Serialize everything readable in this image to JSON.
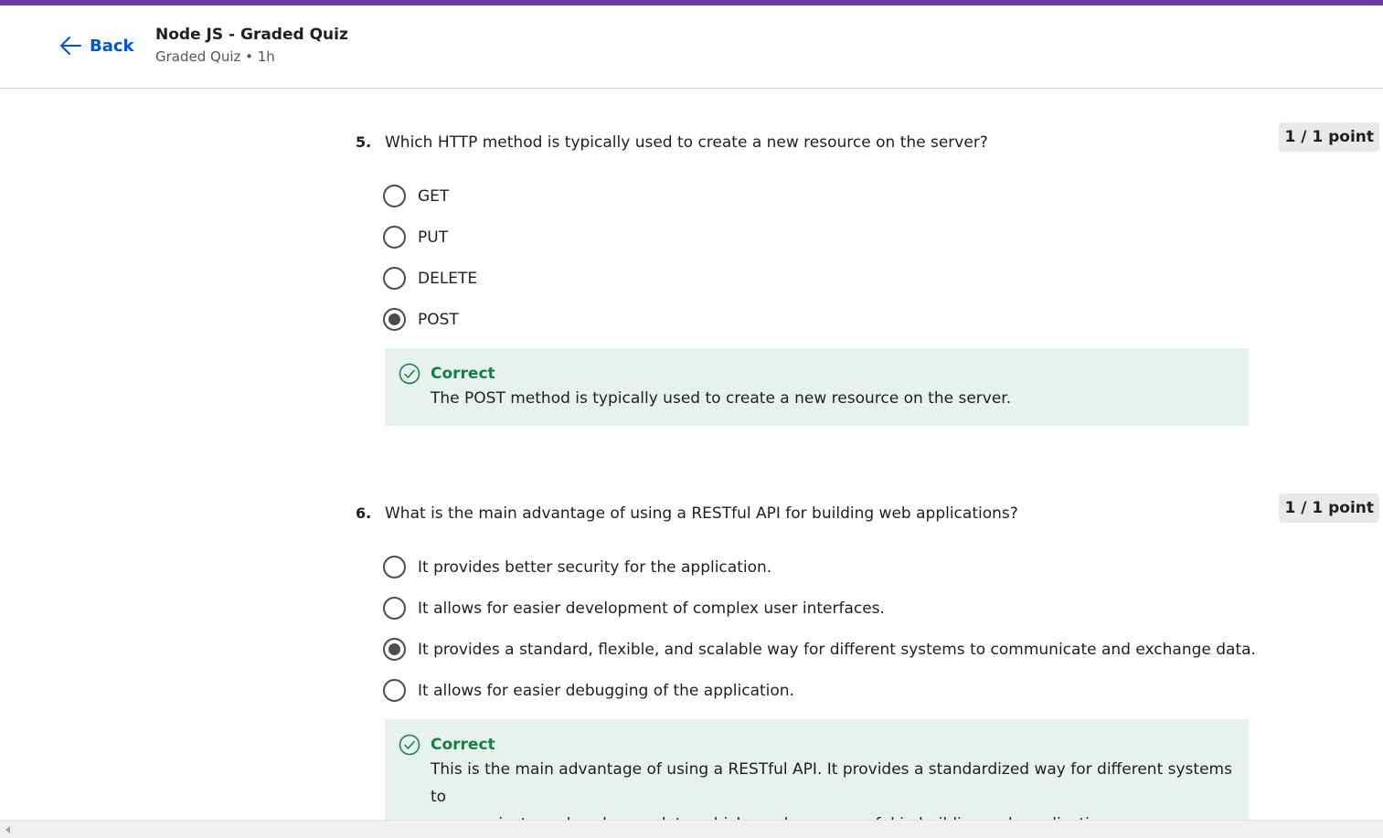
{
  "header": {
    "back_label": "Back",
    "title": "Node JS - Graded Quiz",
    "meta": "Graded Quiz • 1h"
  },
  "colors": {
    "accent": "#6b3fa0",
    "link": "#0056d2",
    "correct": "#137e4a",
    "feedback_bg": "#e6f2ee"
  },
  "questions": [
    {
      "number": "5.",
      "text": "Which HTTP method is typically used to create a new resource on the server?",
      "points": "1 / 1 point",
      "options": [
        {
          "label": "GET",
          "selected": false
        },
        {
          "label": "PUT",
          "selected": false
        },
        {
          "label": "DELETE",
          "selected": false
        },
        {
          "label": "POST",
          "selected": true
        }
      ],
      "feedback": {
        "status": "Correct",
        "lines": [
          "The POST method is typically used to create a new resource on the server."
        ]
      }
    },
    {
      "number": "6.",
      "text": "What is the main advantage of using a RESTful API for building web applications?",
      "points": "1 / 1 point",
      "options": [
        {
          "label": "It provides better security for the application.",
          "selected": false
        },
        {
          "label": "It allows for easier development of complex user interfaces.",
          "selected": false
        },
        {
          "label": "It provides a standard, flexible, and scalable way for different systems to communicate and exchange data.",
          "selected": true
        },
        {
          "label": "It allows for easier debugging of the application.",
          "selected": false
        }
      ],
      "feedback": {
        "status": "Correct",
        "lines": [
          "This is the main advantage of using a RESTful API. It provides a standardized way for different systems to",
          "communicate and exchange data, which can be very useful in building web applications."
        ]
      }
    }
  ]
}
